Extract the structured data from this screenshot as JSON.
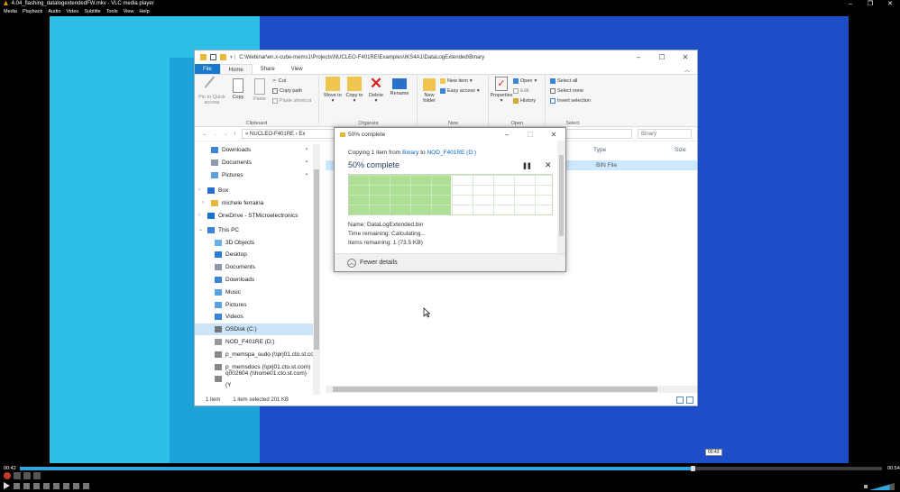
{
  "vlc": {
    "title": "4.04_flashing_datalogextendedFW.mkv - VLC media player",
    "menu": [
      "Media",
      "Playback",
      "Audio",
      "Video",
      "Subtitle",
      "Tools",
      "View",
      "Help"
    ],
    "time_elapsed": "00:42",
    "time_total": "00:54",
    "hover_time": "00:43",
    "progress_fraction": 0.78,
    "volume_fraction": 0.8,
    "accent": "#2fa6df"
  },
  "explorer": {
    "path_title": "C:\\Webinar\\en.x-cube-mems1\\Projects\\NUCLEO-F401RE\\Examples\\IKS4A1\\DataLogExtended\\Binary",
    "tabs": [
      "File",
      "Home",
      "Share",
      "View"
    ],
    "ribbon": {
      "clipboard": {
        "pin": "Pin to Quick access",
        "copy": "Copy",
        "paste": "Paste",
        "cut": "Cut",
        "copy_path": "Copy path",
        "paste_shortcut": "Paste shortcut",
        "label": "Clipboard"
      },
      "organize": {
        "move_to": "Move to",
        "copy_to": "Copy to",
        "delete": "Delete",
        "rename": "Rename",
        "label": "Organize"
      },
      "new": {
        "new_folder": "New folder",
        "new_item": "New item",
        "easy_access": "Easy access",
        "label": "New"
      },
      "open": {
        "properties": "Properties",
        "open": "Open",
        "edit": "Edit",
        "history": "History",
        "label": "Open"
      },
      "select": {
        "select_all": "Select all",
        "select_none": "Select none",
        "invert": "Invert selection",
        "label": "Select"
      }
    },
    "address": "« NUCLEO-F401RE › Ex",
    "search_placeholder": "Binary",
    "nav_items": [
      {
        "label": "Downloads",
        "pinned": true
      },
      {
        "label": "Documents",
        "pinned": true
      },
      {
        "label": "Pictures",
        "pinned": true
      },
      {
        "label": "Box"
      },
      {
        "label": "michele ferraina"
      },
      {
        "label": "OneDrive - STMicroelectronics"
      },
      {
        "label": "This PC"
      },
      {
        "label": "3D Objects"
      },
      {
        "label": "Desktop"
      },
      {
        "label": "Documents"
      },
      {
        "label": "Downloads"
      },
      {
        "label": "Music"
      },
      {
        "label": "Pictures"
      },
      {
        "label": "Videos"
      },
      {
        "label": "OSDisk (C:)"
      },
      {
        "label": "NOD_F401RE (D:)"
      },
      {
        "label": "p_memspa_sudo (\\\\prj01.cto.st.co"
      },
      {
        "label": "p_memsdocs (\\\\prj01.cto.st.com)"
      },
      {
        "label": "q002604 (\\\\home01.cto.st.com) (Y"
      }
    ],
    "columns": {
      "type": "Type",
      "size": "Size"
    },
    "file_type": "BIN File",
    "status": {
      "items": "1 item",
      "selected": "1 item selected  201 KB"
    }
  },
  "copy_dialog": {
    "title": "50% complete",
    "copying_prefix": "Copying 1 item from",
    "source": "Binary",
    "to": "to",
    "destination": "NOD_F401RE (D:)",
    "percent_text": "50% complete",
    "progress_fraction": 0.5,
    "name_line": "Name: DataLogExtended.bin",
    "time_line": "Time remaining: Calculating...",
    "items_line": "Items remaining: 1 (73.5 KB)",
    "fewer_details": "Fewer details",
    "graph_color": "#a4dc8a"
  }
}
